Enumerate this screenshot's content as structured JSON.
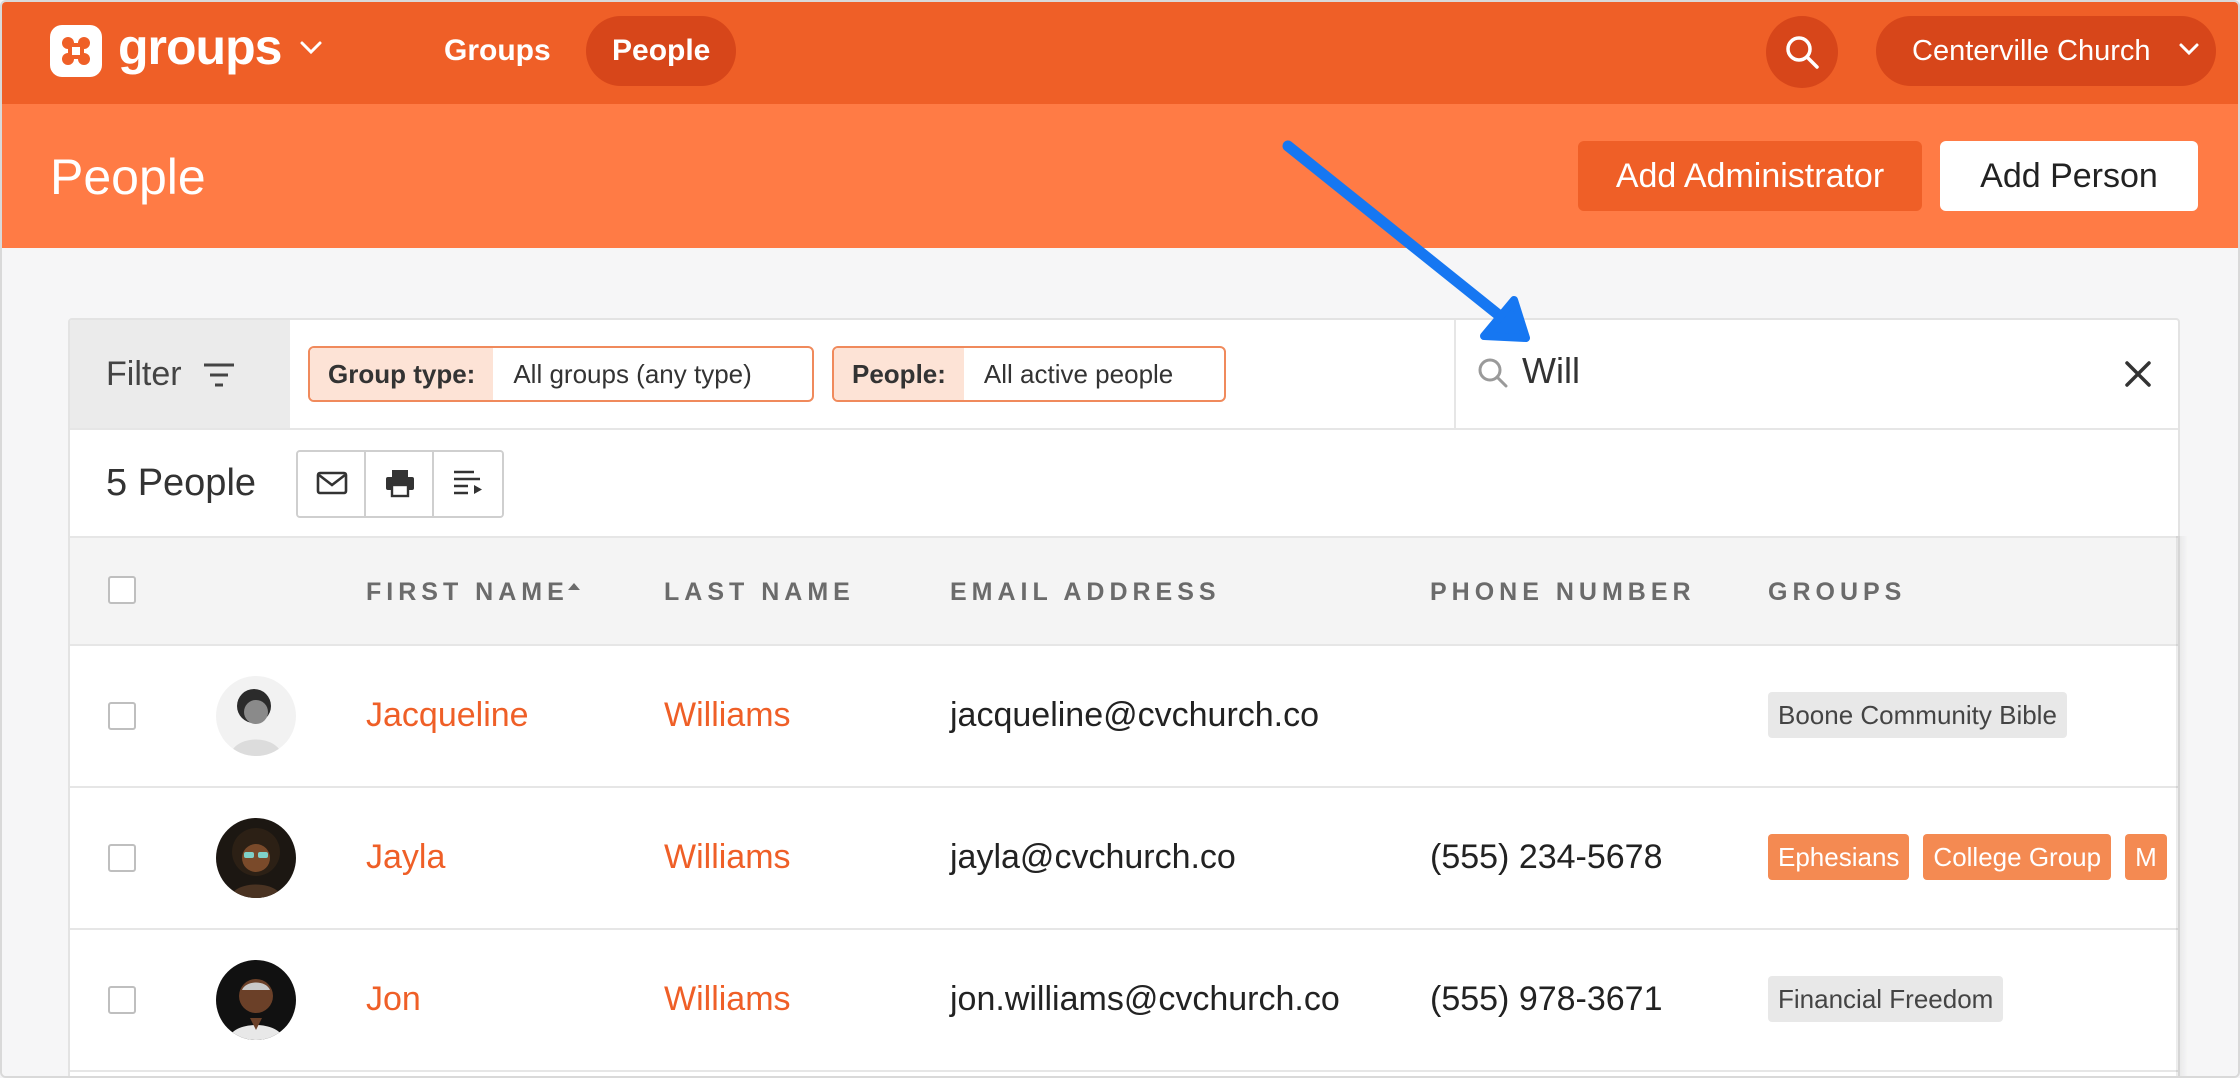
{
  "topnav": {
    "logo_text": "groups",
    "nav": [
      {
        "label": "Groups",
        "active": false
      },
      {
        "label": "People",
        "active": true
      }
    ],
    "org_name": "Centerville Church"
  },
  "header": {
    "title": "People",
    "add_admin_label": "Add Administrator",
    "add_person_label": "Add Person"
  },
  "filters": {
    "filter_label": "Filter",
    "chips": [
      {
        "key": "Group type:",
        "value": "All groups (any type)"
      },
      {
        "key": "People:",
        "value": "All active people"
      }
    ],
    "search_value": "Will"
  },
  "list": {
    "count_label": "5 People",
    "tools": [
      "mail-icon",
      "print-icon",
      "sort-list-icon"
    ],
    "columns": [
      "FIRST NAME",
      "LAST NAME",
      "EMAIL ADDRESS",
      "PHONE NUMBER",
      "GROUPS"
    ],
    "rows": [
      {
        "first": "Jacqueline",
        "last": "Williams",
        "email": "jacqueline@cvchurch.co",
        "phone": "",
        "groups": [
          "Boone Community Bible"
        ]
      },
      {
        "first": "Jayla",
        "last": "Williams",
        "email": "jayla@cvchurch.co",
        "phone": "(555) 234-5678",
        "groups": [
          "Ephesians",
          "College Group",
          "M"
        ]
      },
      {
        "first": "Jon",
        "last": "Williams",
        "email": "jon.williams@cvchurch.co",
        "phone": "(555) 978-3671",
        "groups": [
          "Financial Freedom"
        ]
      }
    ]
  },
  "colors": {
    "brand": "#ef5f27",
    "brand_dark": "#d7461a",
    "header_bg": "#ff7b45",
    "annotation_arrow": "#1677f2"
  }
}
